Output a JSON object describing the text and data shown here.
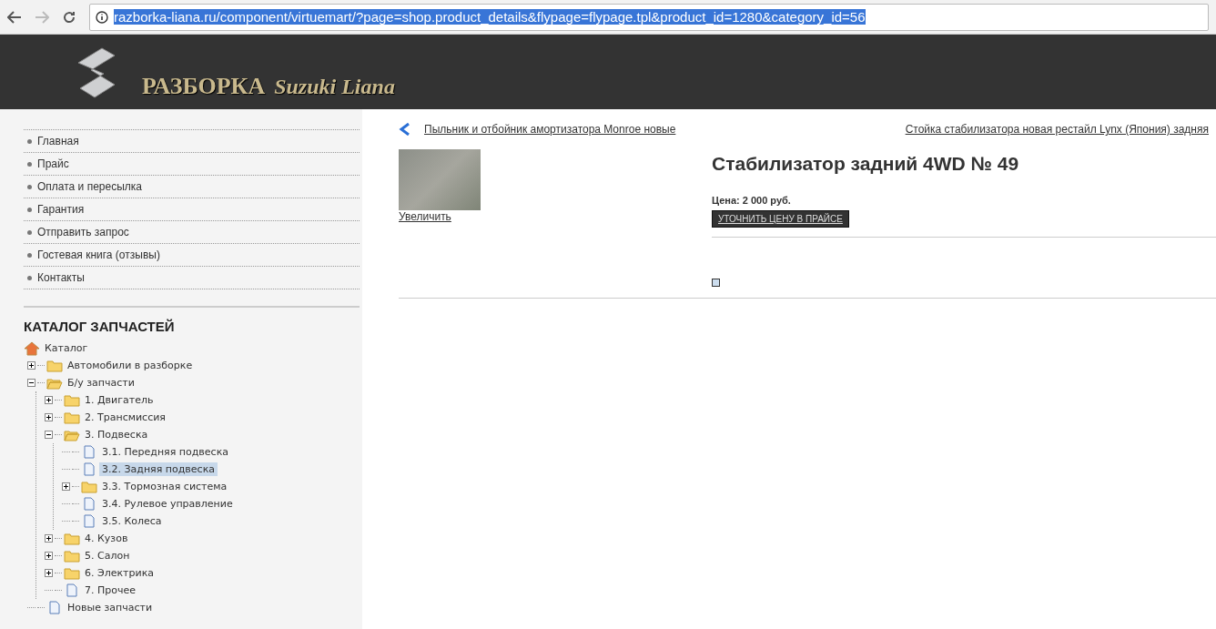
{
  "browser": {
    "url": "razborka-liana.ru/component/virtuemart/?page=shop.product_details&flypage=flypage.tpl&product_id=1280&category_id=56"
  },
  "header": {
    "title": "РАЗБОРКА",
    "subtitle": "Suzuki Liana"
  },
  "menu": [
    "Главная",
    "Прайс",
    "Оплата и пересылка",
    "Гарантия",
    "Отправить запрос",
    "Гостевая книга (отзывы)",
    "Контакты"
  ],
  "catalog": {
    "heading": "КАТАЛОГ ЗАПЧАСТЕЙ",
    "root": "Каталог",
    "tree": [
      {
        "label": "Автомобили в разборке",
        "kind": "folder",
        "expanded": false,
        "selected": false
      },
      {
        "label": "Б/у запчасти",
        "kind": "folder",
        "expanded": true,
        "selected": false,
        "children": [
          {
            "label": "1. Двигатель",
            "kind": "folder",
            "expanded": false,
            "selected": false
          },
          {
            "label": "2. Трансмиссия",
            "kind": "folder",
            "expanded": false,
            "selected": false
          },
          {
            "label": "3. Подвеска",
            "kind": "folder",
            "expanded": true,
            "selected": false,
            "children": [
              {
                "label": "3.1. Передняя подвеска",
                "kind": "page",
                "selected": false
              },
              {
                "label": "3.2. Задняя подвеска",
                "kind": "page",
                "selected": true
              },
              {
                "label": "3.3. Тормозная система",
                "kind": "folder",
                "expanded": false,
                "selected": false
              },
              {
                "label": "3.4. Рулевое управление",
                "kind": "page",
                "selected": false
              },
              {
                "label": "3.5. Колеса",
                "kind": "page",
                "selected": false
              }
            ]
          },
          {
            "label": "4. Кузов",
            "kind": "folder",
            "expanded": false,
            "selected": false
          },
          {
            "label": "5. Салон",
            "kind": "folder",
            "expanded": false,
            "selected": false
          },
          {
            "label": "6. Электрика",
            "kind": "folder",
            "expanded": false,
            "selected": false
          },
          {
            "label": "7. Прочее",
            "kind": "page",
            "selected": false
          }
        ]
      },
      {
        "label": "Новые запчасти",
        "kind": "page",
        "selected": false
      }
    ]
  },
  "product": {
    "prev_link": "Пыльник и отбойник амортизатора Monroe новые",
    "next_link": "Стойка стабилизатора новая рестайл Lynx (Япония) задняя",
    "zoom_link": "Увеличить",
    "title": "Стабилизатор задний 4WD № 49",
    "price": "Цена: 2 000 руб.",
    "price_button": "УТОЧНИТЬ ЦЕНУ В ПРАЙСЕ"
  }
}
